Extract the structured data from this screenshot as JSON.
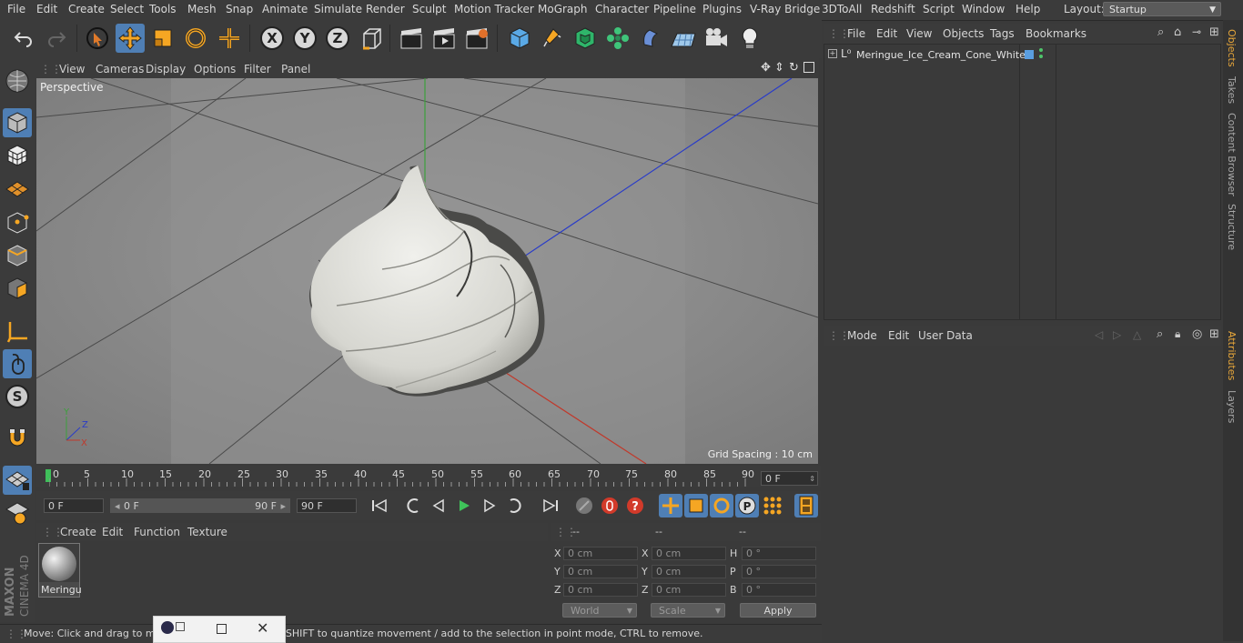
{
  "menubar": {
    "items": [
      "File",
      "Edit",
      "Create",
      "Select",
      "Tools",
      "Mesh",
      "Snap",
      "Animate",
      "Simulate",
      "Render",
      "Sculpt",
      "Motion Tracker",
      "MoGraph",
      "Character",
      "Pipeline",
      "Plugins",
      "V-Ray Bridge",
      "3DToAll",
      "Redshift",
      "Script",
      "Window",
      "Help"
    ],
    "layout_label": "Layout:",
    "layout_value": "Startup"
  },
  "viewport": {
    "menu": [
      "View",
      "Cameras",
      "Display",
      "Options",
      "Filter",
      "Panel"
    ],
    "label": "Perspective",
    "grid_spacing": "Grid Spacing : 10 cm"
  },
  "timeline": {
    "ticks": [
      "0",
      "5",
      "10",
      "15",
      "20",
      "25",
      "30",
      "35",
      "40",
      "45",
      "50",
      "55",
      "60",
      "65",
      "70",
      "75",
      "80",
      "85",
      "90"
    ],
    "current_frame": "0 F"
  },
  "transport": {
    "start_field": "0 F",
    "range_start": "0 F",
    "range_end": "90 F",
    "end_field": "90 F"
  },
  "material_manager": {
    "menu": [
      "Create",
      "Edit",
      "Function",
      "Texture"
    ],
    "material_name": "Meringu"
  },
  "coordinates": {
    "headers": [
      "--",
      "--",
      "--"
    ],
    "rows": [
      {
        "a": "X",
        "av": "0 cm",
        "b": "X",
        "bv": "0 cm",
        "c": "H",
        "cv": "0 °"
      },
      {
        "a": "Y",
        "av": "0 cm",
        "b": "Y",
        "bv": "0 cm",
        "c": "P",
        "cv": "0 °"
      },
      {
        "a": "Z",
        "av": "0 cm",
        "b": "Z",
        "bv": "0 cm",
        "c": "B",
        "cv": "0 °"
      }
    ],
    "world": "World",
    "scale": "Scale",
    "apply": "Apply"
  },
  "status": {
    "text": "Move: Click and drag to move elements. Hold down SHIFT to quantize movement / add to the selection in point mode, CTRL to remove."
  },
  "object_manager": {
    "menu": [
      "File",
      "Edit",
      "View",
      "Objects",
      "Tags",
      "Bookmarks"
    ],
    "object_name": "Meringue_Ice_Cream_Cone_White"
  },
  "attribute_manager": {
    "menu": [
      "Mode",
      "Edit",
      "User Data"
    ]
  },
  "side_tabs": [
    "Objects",
    "Takes",
    "Content Browser",
    "Structure",
    "Attributes",
    "Layers"
  ],
  "logo": {
    "line1": "MAXON",
    "line2": "CINEMA 4D"
  },
  "colors": {
    "accent": "#4f7fb5",
    "active_tab": "#e8a73a",
    "axis_x": "#c0392b",
    "axis_y": "#3ca03c",
    "axis_z": "#2a3cc8"
  }
}
